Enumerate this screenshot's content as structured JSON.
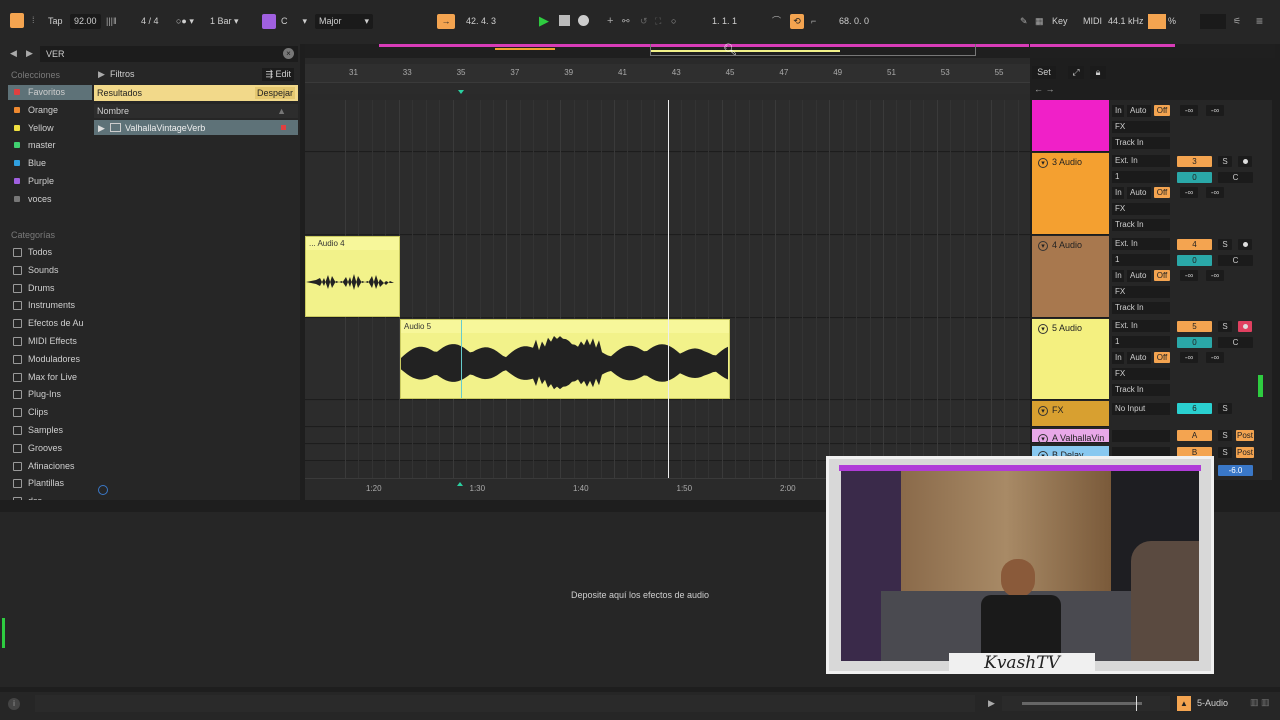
{
  "transport": {
    "tap": "Tap",
    "tempo": "92.00",
    "signature": "4 / 4",
    "quantize": "1 Bar",
    "key": "C",
    "scale": "Major",
    "position": "42.  4.  3",
    "loop_start": "1.  1.  1",
    "loop_length": "68.  0.  0",
    "key_label": "Key",
    "midi_label": "MIDI",
    "sample_rate": "44.1 kHz",
    "cpu": "%"
  },
  "browser": {
    "search": "VER",
    "collections_title": "Colecciones",
    "collections": [
      {
        "label": "Favoritos",
        "color": "#e04040"
      },
      {
        "label": "Orange",
        "color": "#f08a30"
      },
      {
        "label": "Yellow",
        "color": "#f0e040"
      },
      {
        "label": "master",
        "color": "#40d070"
      },
      {
        "label": "Blue",
        "color": "#30a0e0"
      },
      {
        "label": "Purple",
        "color": "#a060e0"
      },
      {
        "label": "voces",
        "color": "#777777"
      }
    ],
    "categories_title": "Categorías",
    "categories": [
      "Todos",
      "Sounds",
      "Drums",
      "Instruments",
      "Efectos de Au",
      "MIDI Effects",
      "Moduladores",
      "Max for Live",
      "Plug-Ins",
      "Clips",
      "Samples",
      "Grooves",
      "Afinaciones",
      "Plantillas",
      "dss"
    ],
    "filters_label": "Filtros",
    "edit_label": "Edit",
    "results_label": "Resultados",
    "clear_label": "Despejar",
    "name_header": "Nombre",
    "result_item": "ValhallaVintageVerb"
  },
  "ruler": {
    "bars": [
      "31",
      "33",
      "35",
      "37",
      "39",
      "41",
      "43",
      "45",
      "47",
      "49",
      "51",
      "53",
      "55"
    ],
    "times": [
      "1:20",
      "1:30",
      "1:40",
      "1:50",
      "2:00"
    ],
    "set_label": "Set"
  },
  "clips": {
    "audio4": "... Audio 4",
    "audio5": "Audio 5"
  },
  "tracks": [
    {
      "name": "",
      "number": "",
      "color": "#f020c8"
    },
    {
      "name": "3 Audio",
      "number": "3",
      "color": "#f4a030"
    },
    {
      "name": "4 Audio",
      "number": "4",
      "color": "#a8784e"
    },
    {
      "name": "5 Audio",
      "number": "5",
      "color": "#f4f080"
    },
    {
      "name": "FX",
      "number": "6",
      "color": "#d8a030"
    },
    {
      "name": "A ValhallaVin",
      "number": "A",
      "color": "#e8a8e8"
    },
    {
      "name": "B Delay",
      "number": "B",
      "color": "#88c8f0"
    }
  ],
  "mixer": {
    "in": "In",
    "auto": "Auto",
    "off": "Off",
    "inf": "-∞",
    "fx": "FX",
    "track_in": "Track In",
    "ext_in": "Ext. In",
    "channel": "1",
    "vol": "0",
    "pan": "C",
    "solo": "S",
    "no_input": "No Input",
    "post": "Post",
    "master_vol": "-6.0"
  },
  "detail": {
    "drop_hint": "Deposite aquí los efectos de audio"
  },
  "status": {
    "track": "5-Audio"
  },
  "webcam": {
    "brand": "KvashTV"
  }
}
